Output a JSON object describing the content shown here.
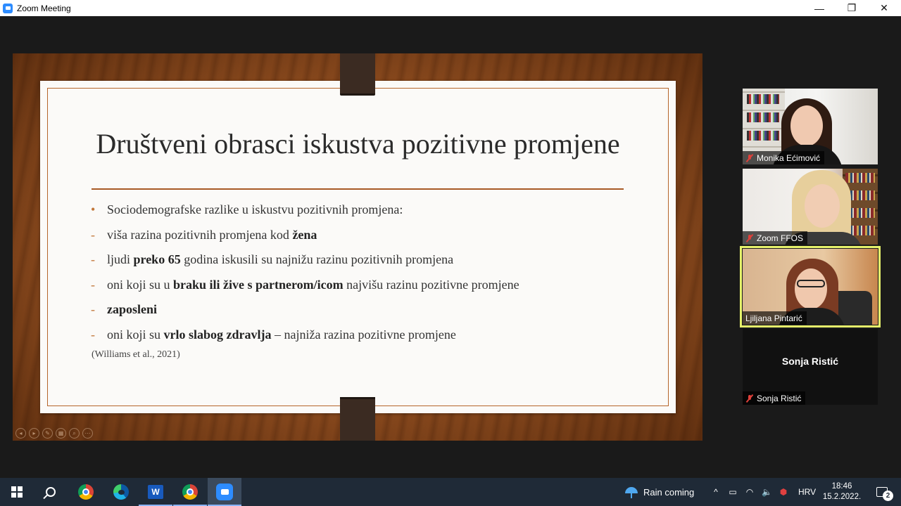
{
  "window": {
    "title": "Zoom Meeting",
    "controls": {
      "minimize": "—",
      "restore": "❐",
      "close": "✕"
    }
  },
  "slide": {
    "title": "Društveni obrasci iskustva pozitivne promjene",
    "bullets": [
      {
        "mark": "•",
        "parts": [
          {
            "text": "Sociodemografske razlike u iskustvu pozitivnih promjena:",
            "bold": false
          }
        ]
      },
      {
        "mark": "-",
        "parts": [
          {
            "text": "viša razina pozitivnih promjena kod ",
            "bold": false
          },
          {
            "text": "žena",
            "bold": true
          }
        ]
      },
      {
        "mark": "-",
        "parts": [
          {
            "text": "ljudi ",
            "bold": false
          },
          {
            "text": "preko 65",
            "bold": true
          },
          {
            "text": " godina iskusili su najnižu razinu pozitivnih promjena",
            "bold": false
          }
        ]
      },
      {
        "mark": "-",
        "parts": [
          {
            "text": "oni koji su u ",
            "bold": false
          },
          {
            "text": "braku ili žive s partnerom/icom",
            "bold": true
          },
          {
            "text": " najvišu razinu pozitivne promjene",
            "bold": false
          }
        ]
      },
      {
        "mark": "-",
        "parts": [
          {
            "text": "zaposleni",
            "bold": true
          }
        ]
      },
      {
        "mark": "-",
        "parts": [
          {
            "text": "oni koji su ",
            "bold": false
          },
          {
            "text": "vrlo slabog zdravlja",
            "bold": true
          },
          {
            "text": " – najniža razina pozitivne promjene",
            "bold": false
          }
        ]
      }
    ],
    "citation": "(Williams et al., 2021)",
    "annotation_tools": [
      "back-icon",
      "pointer-icon",
      "pen-icon",
      "slides-icon",
      "zoom-icon",
      "more-icon"
    ]
  },
  "participants": [
    {
      "name": "Monika Ećimović",
      "muted": true,
      "video": true,
      "active_speaker": false
    },
    {
      "name": "Zoom FFOS",
      "muted": true,
      "video": true,
      "active_speaker": false
    },
    {
      "name": "Ljiljana Pintarić",
      "muted": false,
      "video": true,
      "active_speaker": true
    },
    {
      "name": "Sonja Ristić",
      "muted": true,
      "video": false,
      "active_speaker": false
    }
  ],
  "taskbar": {
    "apps": [
      "start-icon",
      "search-icon",
      "chrome-icon",
      "edge-icon",
      "word-icon",
      "chrome-profile-icon",
      "zoom-icon"
    ],
    "word_letter": "W",
    "weather": "Rain coming",
    "tray_symbols": {
      "chevron": "^",
      "battery": "▭",
      "wifi": "◠",
      "volume": "🔈",
      "app": "⬢"
    },
    "language": "HRV",
    "time": "18:46",
    "date": "15.2.2022.",
    "notifications": "2"
  }
}
